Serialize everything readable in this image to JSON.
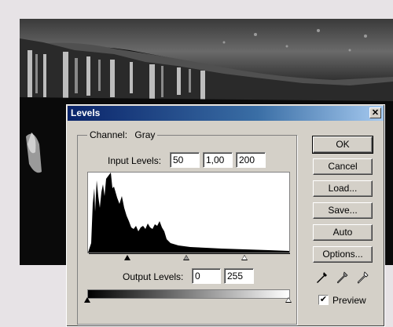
{
  "dialog": {
    "title": "Levels",
    "close_glyph": "✕",
    "channel_label": "Channel:",
    "channel_value": "Gray",
    "input_levels_label": "Input Levels:",
    "input_levels": [
      "50",
      "1,00",
      "200"
    ],
    "output_levels_label": "Output Levels:",
    "output_levels": [
      "0",
      "255"
    ],
    "buttons": {
      "ok": "OK",
      "cancel": "Cancel",
      "load": "Load...",
      "save": "Save...",
      "auto": "Auto",
      "options": "Options..."
    },
    "preview_label": "Preview",
    "preview_checked": true,
    "check_glyph": "✔",
    "eyedroppers": [
      "black-eyedropper-icon",
      "gray-eyedropper-icon",
      "white-eyedropper-icon"
    ],
    "colors": {
      "title_start": "#0a246a",
      "title_end": "#a6caf0",
      "face": "#d4d0c8"
    }
  }
}
